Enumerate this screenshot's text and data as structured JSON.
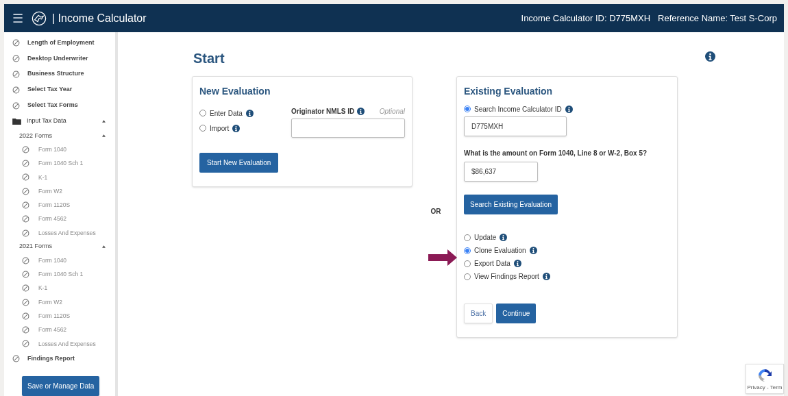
{
  "header": {
    "menu_icon": "☰",
    "title": "| Income Calculator",
    "calculator_id": "Income Calculator ID: D775MXH",
    "reference_name": "Reference Name: Test S-Corp"
  },
  "sidebar": {
    "items": [
      {
        "label": "Length of Employment",
        "kind": "step"
      },
      {
        "label": "Desktop Underwriter",
        "kind": "step"
      },
      {
        "label": "Business Structure",
        "kind": "step"
      },
      {
        "label": "Select Tax Year",
        "kind": "step"
      },
      {
        "label": "Select Tax Forms",
        "kind": "step"
      },
      {
        "label": "Input Tax Data",
        "kind": "folder",
        "expanded": true,
        "children": [
          {
            "label": "2022 Forms",
            "kind": "group",
            "expanded": true,
            "children": [
              {
                "label": "Form 1040",
                "kind": "form"
              },
              {
                "label": "Form 1040 Sch 1",
                "kind": "form"
              },
              {
                "label": "K-1",
                "kind": "form"
              },
              {
                "label": "Form W2",
                "kind": "form"
              },
              {
                "label": "Form 1120S",
                "kind": "form"
              },
              {
                "label": "Form 4562",
                "kind": "form"
              },
              {
                "label": "Losses And Expenses",
                "kind": "form"
              }
            ]
          },
          {
            "label": "2021 Forms",
            "kind": "group",
            "expanded": true,
            "children": [
              {
                "label": "Form 1040",
                "kind": "form"
              },
              {
                "label": "Form 1040 Sch 1",
                "kind": "form"
              },
              {
                "label": "K-1",
                "kind": "form"
              },
              {
                "label": "Form W2",
                "kind": "form"
              },
              {
                "label": "Form 1120S",
                "kind": "form"
              },
              {
                "label": "Form 4562",
                "kind": "form"
              },
              {
                "label": "Losses And Expenses",
                "kind": "form"
              }
            ]
          }
        ]
      },
      {
        "label": "Findings Report",
        "kind": "step"
      }
    ],
    "save_button": "Save or Manage Data"
  },
  "page_title": "Start",
  "new_evaluation": {
    "title": "New Evaluation",
    "options": [
      {
        "label": "Enter Data",
        "selected": false
      },
      {
        "label": "Import",
        "selected": false
      }
    ],
    "originator_label": "Originator NMLS ID",
    "optional_label": "Optional",
    "start_button": "Start New Evaluation"
  },
  "or_label": "OR",
  "existing_evaluation": {
    "title": "Existing Evaluation",
    "search_option": {
      "label": "Search Income Calculator ID",
      "selected": true
    },
    "id_value": "D775MXH",
    "amount_question": "What is the amount on Form 1040, Line 8 or W-2, Box 5?",
    "amount_value": "$86,637",
    "search_button": "Search Existing Evaluation",
    "actions": [
      {
        "label": "Update",
        "selected": false
      },
      {
        "label": "Clone Evaluation",
        "selected": true
      },
      {
        "label": "Export Data",
        "selected": false
      },
      {
        "label": "View Findings Report",
        "selected": false
      }
    ],
    "back_button": "Back",
    "continue_button": "Continue"
  },
  "recaptcha": {
    "text": "Privacy - Term"
  }
}
